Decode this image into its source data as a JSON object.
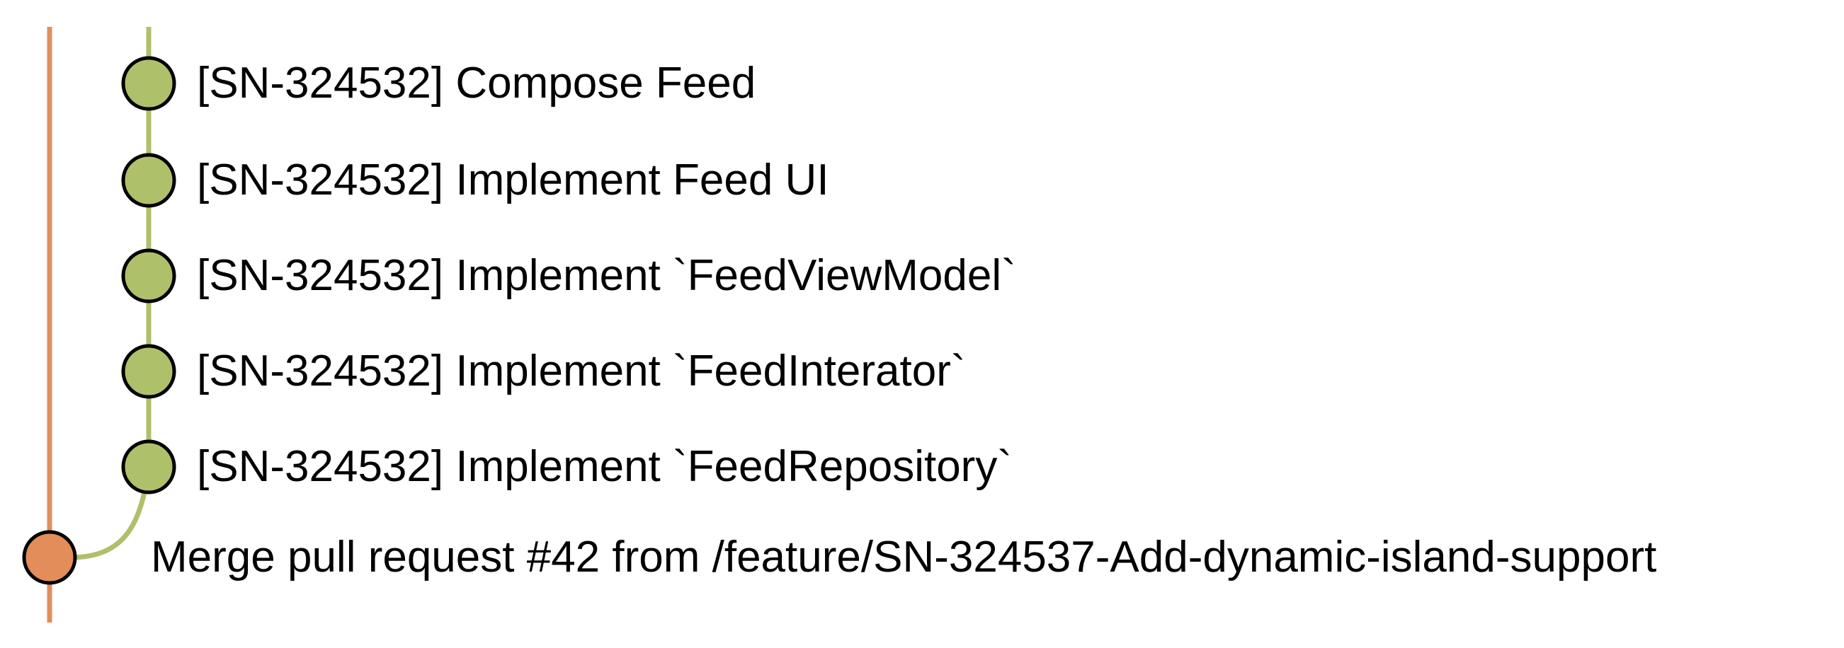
{
  "colors": {
    "main_branch": "#e28d5a",
    "feature_branch": "#afc06a",
    "node_stroke": "#000000",
    "text": "#000000"
  },
  "feature_commits": [
    {
      "message": "[SN-324532] Compose Feed"
    },
    {
      "message": "[SN-324532] Implement Feed UI"
    },
    {
      "message": "[SN-324532] Implement `FeedViewModel`"
    },
    {
      "message": "[SN-324532] Implement `FeedInterator`"
    },
    {
      "message": "[SN-324532] Implement `FeedRepository`"
    }
  ],
  "merge_commit": {
    "message": "Merge pull request #42 from /feature/SN-324537-Add-dynamic-island-support"
  }
}
